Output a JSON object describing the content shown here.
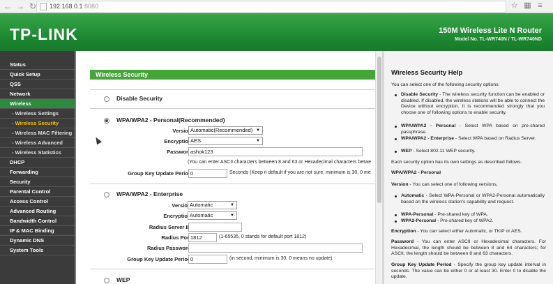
{
  "browser": {
    "url_host": "192.168.0.1",
    "url_port": ":8080"
  },
  "header": {
    "logo": "TP-LINK",
    "product": "150M Wireless Lite N Router",
    "model": "Model No. TL-WR740N / TL-WR740ND"
  },
  "sidebar": {
    "items": [
      {
        "label": "Status"
      },
      {
        "label": "Quick Setup"
      },
      {
        "label": "QSS"
      },
      {
        "label": "Network"
      },
      {
        "label": "Wireless"
      },
      {
        "label": "- Wireless Settings"
      },
      {
        "label": "- Wireless Security"
      },
      {
        "label": "- Wireless MAC Filtering"
      },
      {
        "label": "- Wireless Advanced"
      },
      {
        "label": "- Wireless Statistics"
      },
      {
        "label": "DHCP"
      },
      {
        "label": "Forwarding"
      },
      {
        "label": "Security"
      },
      {
        "label": "Parental Control"
      },
      {
        "label": "Access Control"
      },
      {
        "label": "Advanced Routing"
      },
      {
        "label": "Bandwidth Control"
      },
      {
        "label": "IP & MAC Binding"
      },
      {
        "label": "Dynamic DNS"
      },
      {
        "label": "System Tools"
      }
    ]
  },
  "main": {
    "title": "Wireless Security",
    "disable": {
      "label": "Disable Security"
    },
    "personal": {
      "label": "WPA/WPA2 - Personal(Recommended)",
      "version_label": "Version:",
      "version_value": "Automatic(Recommended)",
      "encryption_label": "Encryption:",
      "encryption_value": "AES",
      "password_label": "Password:",
      "password_value": "ashok123",
      "password_hint": "(You can enter ASCII characters between 8 and 63 or Hexadecimal characters betwe",
      "gkup_label": "Group Key Update Period:",
      "gkup_value": "0",
      "gkup_hint": "Seconds (Keep it default if you are not sure, minimum is 30, 0 me"
    },
    "enterprise": {
      "label": "WPA/WPA2 - Enterprise",
      "version_label": "Version:",
      "version_value": "Automatic",
      "encryption_label": "Encryption:",
      "encryption_value": "Automatic",
      "radius_ip_label": "Radius Server IP:",
      "radius_port_label": "Radius Port:",
      "radius_port_value": "1812",
      "radius_port_hint": "(1-65535, 0 stands for default port 1812)",
      "radius_pwd_label": "Radius Password:",
      "gkup_label": "Group Key Update Period:",
      "gkup_value": "0",
      "gkup_hint": "(in second, minimum is 30, 0 means no update)"
    },
    "wep": {
      "label": "WEP"
    }
  },
  "help": {
    "title": "Wireless Security Help",
    "intro": "You can select one of the following security options:",
    "bullets": [
      {
        "term": "Disable Security",
        "text": " - The wireless security function can be enabled or disabled. If disabled, the wireless stations will be able to connect the Device without encryption. It is recommended strongly that you choose one of following options to enable security."
      },
      {
        "term": "WPA/WPA2 - Personal",
        "text": " - Select WPA based on pre-shared passphrase."
      },
      {
        "term": "WPA/WPA2 - Enterprise",
        "text": " - Select WPA based on Radius Server."
      },
      {
        "term": "WEP",
        "text": " - Select 802.11 WEP security."
      }
    ],
    "each": "Each security option has its own settings as described follows.",
    "personal_head": "WPA/WPA2 - Personal",
    "version_term": "Version",
    "version_text": " - You can select one of following versions,",
    "vbullets": [
      {
        "term": "Automatic",
        "text": " - Select WPA-Personal or WPA2-Personal automatically based on the wireless station's capability and request."
      },
      {
        "term": "WPA-Personal",
        "text": " - Pre-shared key of WPA."
      },
      {
        "term": "WPA2-Personal",
        "text": " - Pre-shared key of WPA2."
      }
    ],
    "enc_term": "Encryption",
    "enc_text": " - You can select either Automatic, or TKIP or AES.",
    "pwd_term": "Password",
    "pwd_text": " - You can enter ASCII or Hexadecimal characters. For Hexadecimal, the length should be between 8 and 64 characters; for ASCII, the length should be between 8 and 63 characters.",
    "gk_term": "Group Key Update Period",
    "gk_text": " - Specify the group key update interval in seconds. The value can be either 0 or at least 30. Enter 0 to disable the update."
  }
}
